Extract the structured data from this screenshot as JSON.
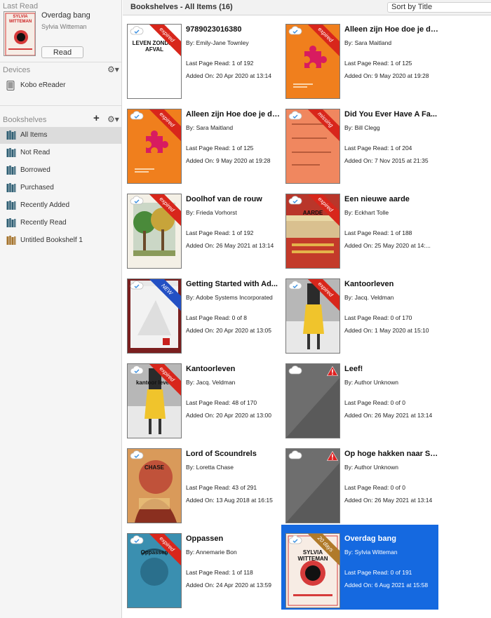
{
  "sidebar": {
    "last_read_title": "Last Read",
    "last_read_book": {
      "title": "Overdag bang",
      "author": "Sylvia Witteman",
      "cover_text": "SYLVIA WITTEMAN",
      "read_label": "Read"
    },
    "devices_title": "Devices",
    "devices": [
      {
        "label": "Kobo eReader",
        "icon": "ereader-icon"
      }
    ],
    "bookshelves_title": "Bookshelves",
    "bookshelves": [
      {
        "label": "All Items",
        "icon": "bookshelf-icon",
        "selected": true,
        "color": "#2f5f74"
      },
      {
        "label": "Not Read",
        "icon": "bookshelf-icon",
        "color": "#2f5f74"
      },
      {
        "label": "Borrowed",
        "icon": "bookshelf-icon",
        "color": "#2f5f74"
      },
      {
        "label": "Purchased",
        "icon": "bookshelf-icon",
        "color": "#2f5f74"
      },
      {
        "label": "Recently Added",
        "icon": "bookshelf-icon",
        "color": "#2f5f74"
      },
      {
        "label": "Recently Read",
        "icon": "bookshelf-icon",
        "color": "#2f5f74"
      },
      {
        "label": "Untitled Bookshelf 1",
        "icon": "bookshelf-icon",
        "color": "#a5732c"
      }
    ]
  },
  "header": {
    "title": "Bookshelves - All Items (16)",
    "sort_value": "Sort by Title"
  },
  "colors": {
    "selection": "#1569e0",
    "ribbon_expired": "#d8261b",
    "ribbon_missing": "#d8261b",
    "ribbon_new": "#2350c4",
    "ribbon_days": "#b07a2a"
  },
  "books": [
    {
      "title": "9789023016380",
      "author": "By: Emily-Jane Townley",
      "last_page": "Last Page Read: 1 of 192",
      "added": "Added On: 20 Apr 2020 at 13:14",
      "ribbon": "expired",
      "cover_style": "white",
      "cover_text": "LEVEN ZONDER AFVAL"
    },
    {
      "title": "Alleen zijn Hoe doe je dat?",
      "author": "By: Sara Maitland",
      "last_page": "Last Page Read: 1 of 125",
      "added": "Added On: 9 May 2020 at 19:28",
      "ribbon": "expired",
      "cover_style": "orange-puzzle",
      "cover_text": ""
    },
    {
      "title": "Alleen zijn Hoe doe je dat?",
      "author": "By: Sara Maitland",
      "last_page": "Last Page Read: 1 of 125",
      "added": "Added On: 9 May 2020 at 19:28",
      "ribbon": "expired",
      "cover_style": "orange-puzzle",
      "cover_text": ""
    },
    {
      "title": "Did You Ever Have A Fa...",
      "author": "By: Bill Clegg",
      "last_page": "Last Page Read: 1 of 204",
      "added": "Added On: 7 Nov 2015 at 21:35",
      "ribbon": "missing",
      "cover_style": "orange-plain",
      "cover_text": ""
    },
    {
      "title": "Doolhof van de rouw",
      "author": "By: Frieda Vorhorst",
      "last_page": "Last Page Read: 1 of 192",
      "added": "Added On: 26 May 2021 at 13:14",
      "ribbon": "expired",
      "cover_style": "tree",
      "cover_text": ""
    },
    {
      "title": "Een nieuwe aarde",
      "author": "By: Eckhart Tolle",
      "last_page": "Last Page Read: 1 of 188",
      "added": "Added On: 25 May 2020 at 14:...",
      "ribbon": "expired",
      "cover_style": "aarde",
      "cover_text": "AARDE"
    },
    {
      "title": "Getting Started with Ad...",
      "author": "By: Adobe Systems Incorporated",
      "last_page": "Last Page Read: 0 of 8",
      "added": "Added On: 20 Apr 2020 at 13:05",
      "ribbon": "NEW",
      "cover_style": "adobe",
      "cover_text": ""
    },
    {
      "title": "Kantoorleven",
      "author": "By: Jacq. Veldman",
      "last_page": "Last Page Read: 0 of 170",
      "added": "Added On: 1 May 2020 at 15:10",
      "ribbon": "expired",
      "cover_style": "kantoor",
      "cover_text": ""
    },
    {
      "title": "Kantoorleven",
      "author": "By: Jacq. Veldman",
      "last_page": "Last Page Read: 48 of 170",
      "added": "Added On: 20 Apr 2020 at 13:00",
      "ribbon": "expired",
      "cover_style": "kantoor",
      "cover_text": "kantoor leven"
    },
    {
      "title": "Leef!",
      "author": "By: Author Unknown",
      "last_page": "Last Page Read: 0 of 0",
      "added": "Added On: 26 May 2021 at 13:14",
      "ribbon": "",
      "cover_style": "grey",
      "cover_text": "",
      "warning": true
    },
    {
      "title": "Lord of Scoundrels",
      "author": "By: Loretta Chase",
      "last_page": "Last Page Read: 43 of 291",
      "added": "Added On: 13 Aug 2018 at 16:15",
      "ribbon": "",
      "cover_style": "romance",
      "cover_text": "CHASE"
    },
    {
      "title": "Op hoge hakken naar Sa...",
      "author": "By: Author Unknown",
      "last_page": "Last Page Read: 0 of 0",
      "added": "Added On: 26 May 2021 at 13:14",
      "ribbon": "",
      "cover_style": "grey",
      "cover_text": "",
      "warning": true
    },
    {
      "title": "Oppassen",
      "author": "By: Annemarie Bon",
      "last_page": "Last Page Read: 1 of 118",
      "added": "Added On: 24 Apr 2020 at 13:59",
      "ribbon": "expired",
      "cover_style": "blue",
      "cover_text": "Oppassen"
    },
    {
      "title": "Overdag bang",
      "author": "By: Sylvia Witteman",
      "last_page": "Last Page Read: 0 of 191",
      "added": "Added On: 6 Aug 2021 at 15:58",
      "ribbon": "20 days",
      "cover_style": "overdag",
      "cover_text": "SYLVIA WITTEMAN",
      "selected": true
    }
  ]
}
